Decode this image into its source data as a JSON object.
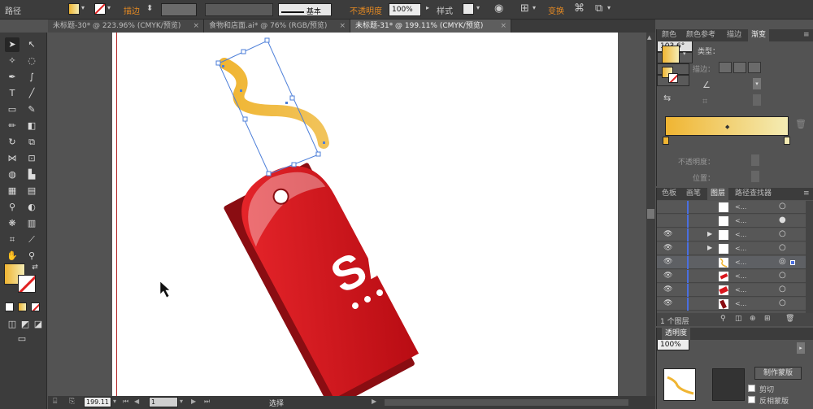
{
  "control_bar": {
    "object_type": "路径",
    "stroke_label": "描边",
    "stroke_weight": "",
    "stroke_profile": "基本",
    "opacity_label": "不透明度",
    "opacity_value": "100%",
    "style_label": "样式",
    "transform_label": "变换"
  },
  "doc_tabs": [
    {
      "label": "未标题-30* @ 223.96% (CMYK/预览)",
      "active": false
    },
    {
      "label": "食物和店面.ai* @ 76% (RGB/预览)",
      "active": false
    },
    {
      "label": "未标题-31* @ 199.11% (CMYK/预览)",
      "active": true
    }
  ],
  "close_glyph": "×",
  "artwork": {
    "tag_text": "SALE"
  },
  "status_bar": {
    "zoom": "199.11",
    "artboard": "1",
    "tool_name": "选择"
  },
  "gradient_panel": {
    "tabs": [
      "颜色",
      "颜色参考",
      "描边",
      "渐变"
    ],
    "type_label": "类型：",
    "type_value": "线性",
    "stroke_label": "描边：",
    "angle_value": "103.6°",
    "opacity_label": "不透明度：",
    "position_label": "位置：",
    "gradient_start": "#f0b532",
    "gradient_end": "#f4ecb4"
  },
  "layers_panel": {
    "tabs": [
      "色板",
      "画笔",
      "图层",
      "路径查找器"
    ],
    "layer_names": [
      "<...",
      "<...",
      "<...",
      "<...",
      "<...",
      "<...",
      "<...",
      "<..."
    ],
    "footer_text": "1 个图层"
  },
  "transparency_panel": {
    "tab": "透明度",
    "opacity": "100%",
    "make_mask_button": "制作蒙版",
    "clip_label": "剪切",
    "invert_label": "反相蒙版"
  },
  "colors": {
    "accent": "#e58a23",
    "tag_red": "#d8161d"
  }
}
